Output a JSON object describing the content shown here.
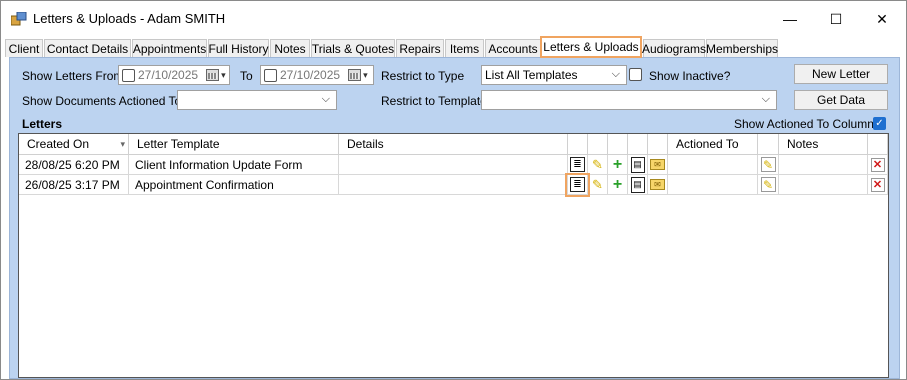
{
  "window": {
    "title": "Letters & Uploads - Adam SMITH",
    "min": "—",
    "max": "☐",
    "close": "✕"
  },
  "tabs": [
    "Client",
    "Contact Details",
    "Appointments",
    "Full History",
    "Notes",
    "Trials & Quotes",
    "Repairs",
    "Items",
    "Accounts",
    "Letters & Uploads",
    "Audiograms",
    "Memberships"
  ],
  "active_tab": "Letters & Uploads",
  "filters": {
    "show_letters_from_label": "Show Letters From",
    "from_date": "27/10/2025",
    "to_label": "To",
    "to_date": "27/10/2025",
    "restrict_type_label": "Restrict to Type",
    "restrict_type_value": "List All Templates",
    "show_inactive_label": "Show Inactive?",
    "new_letter_label": "New Letter",
    "show_documents_label": "Show Documents Actioned To",
    "restrict_template_label": "Restrict to Template",
    "get_data_label": "Get Data"
  },
  "letters": {
    "section_label": "Letters",
    "show_actioned_label": "Show Actioned To Columns",
    "columns": {
      "created_on": "Created On",
      "letter_template": "Letter Template",
      "details": "Details",
      "actioned_to": "Actioned To",
      "notes": "Notes"
    },
    "rows": [
      {
        "created_on": "28/08/25 6:20 PM",
        "template": "Client Information Update Form",
        "details": "",
        "actioned_to": "",
        "notes": ""
      },
      {
        "created_on": "26/08/25 3:17 PM",
        "template": "Appointment Confirmation",
        "details": "",
        "actioned_to": "",
        "notes": ""
      }
    ]
  },
  "icons": {
    "doc": "≣",
    "pencil": "✎",
    "plus": "+",
    "pages": "▤",
    "mail": "✉",
    "delete": "✕",
    "dropdown": "▾",
    "chevron": "⌵",
    "check": "✓"
  },
  "colors": {
    "panel_bg": "#bcd3f0",
    "highlight": "#f0a460",
    "checkbox_blue": "#1e6fd0"
  }
}
